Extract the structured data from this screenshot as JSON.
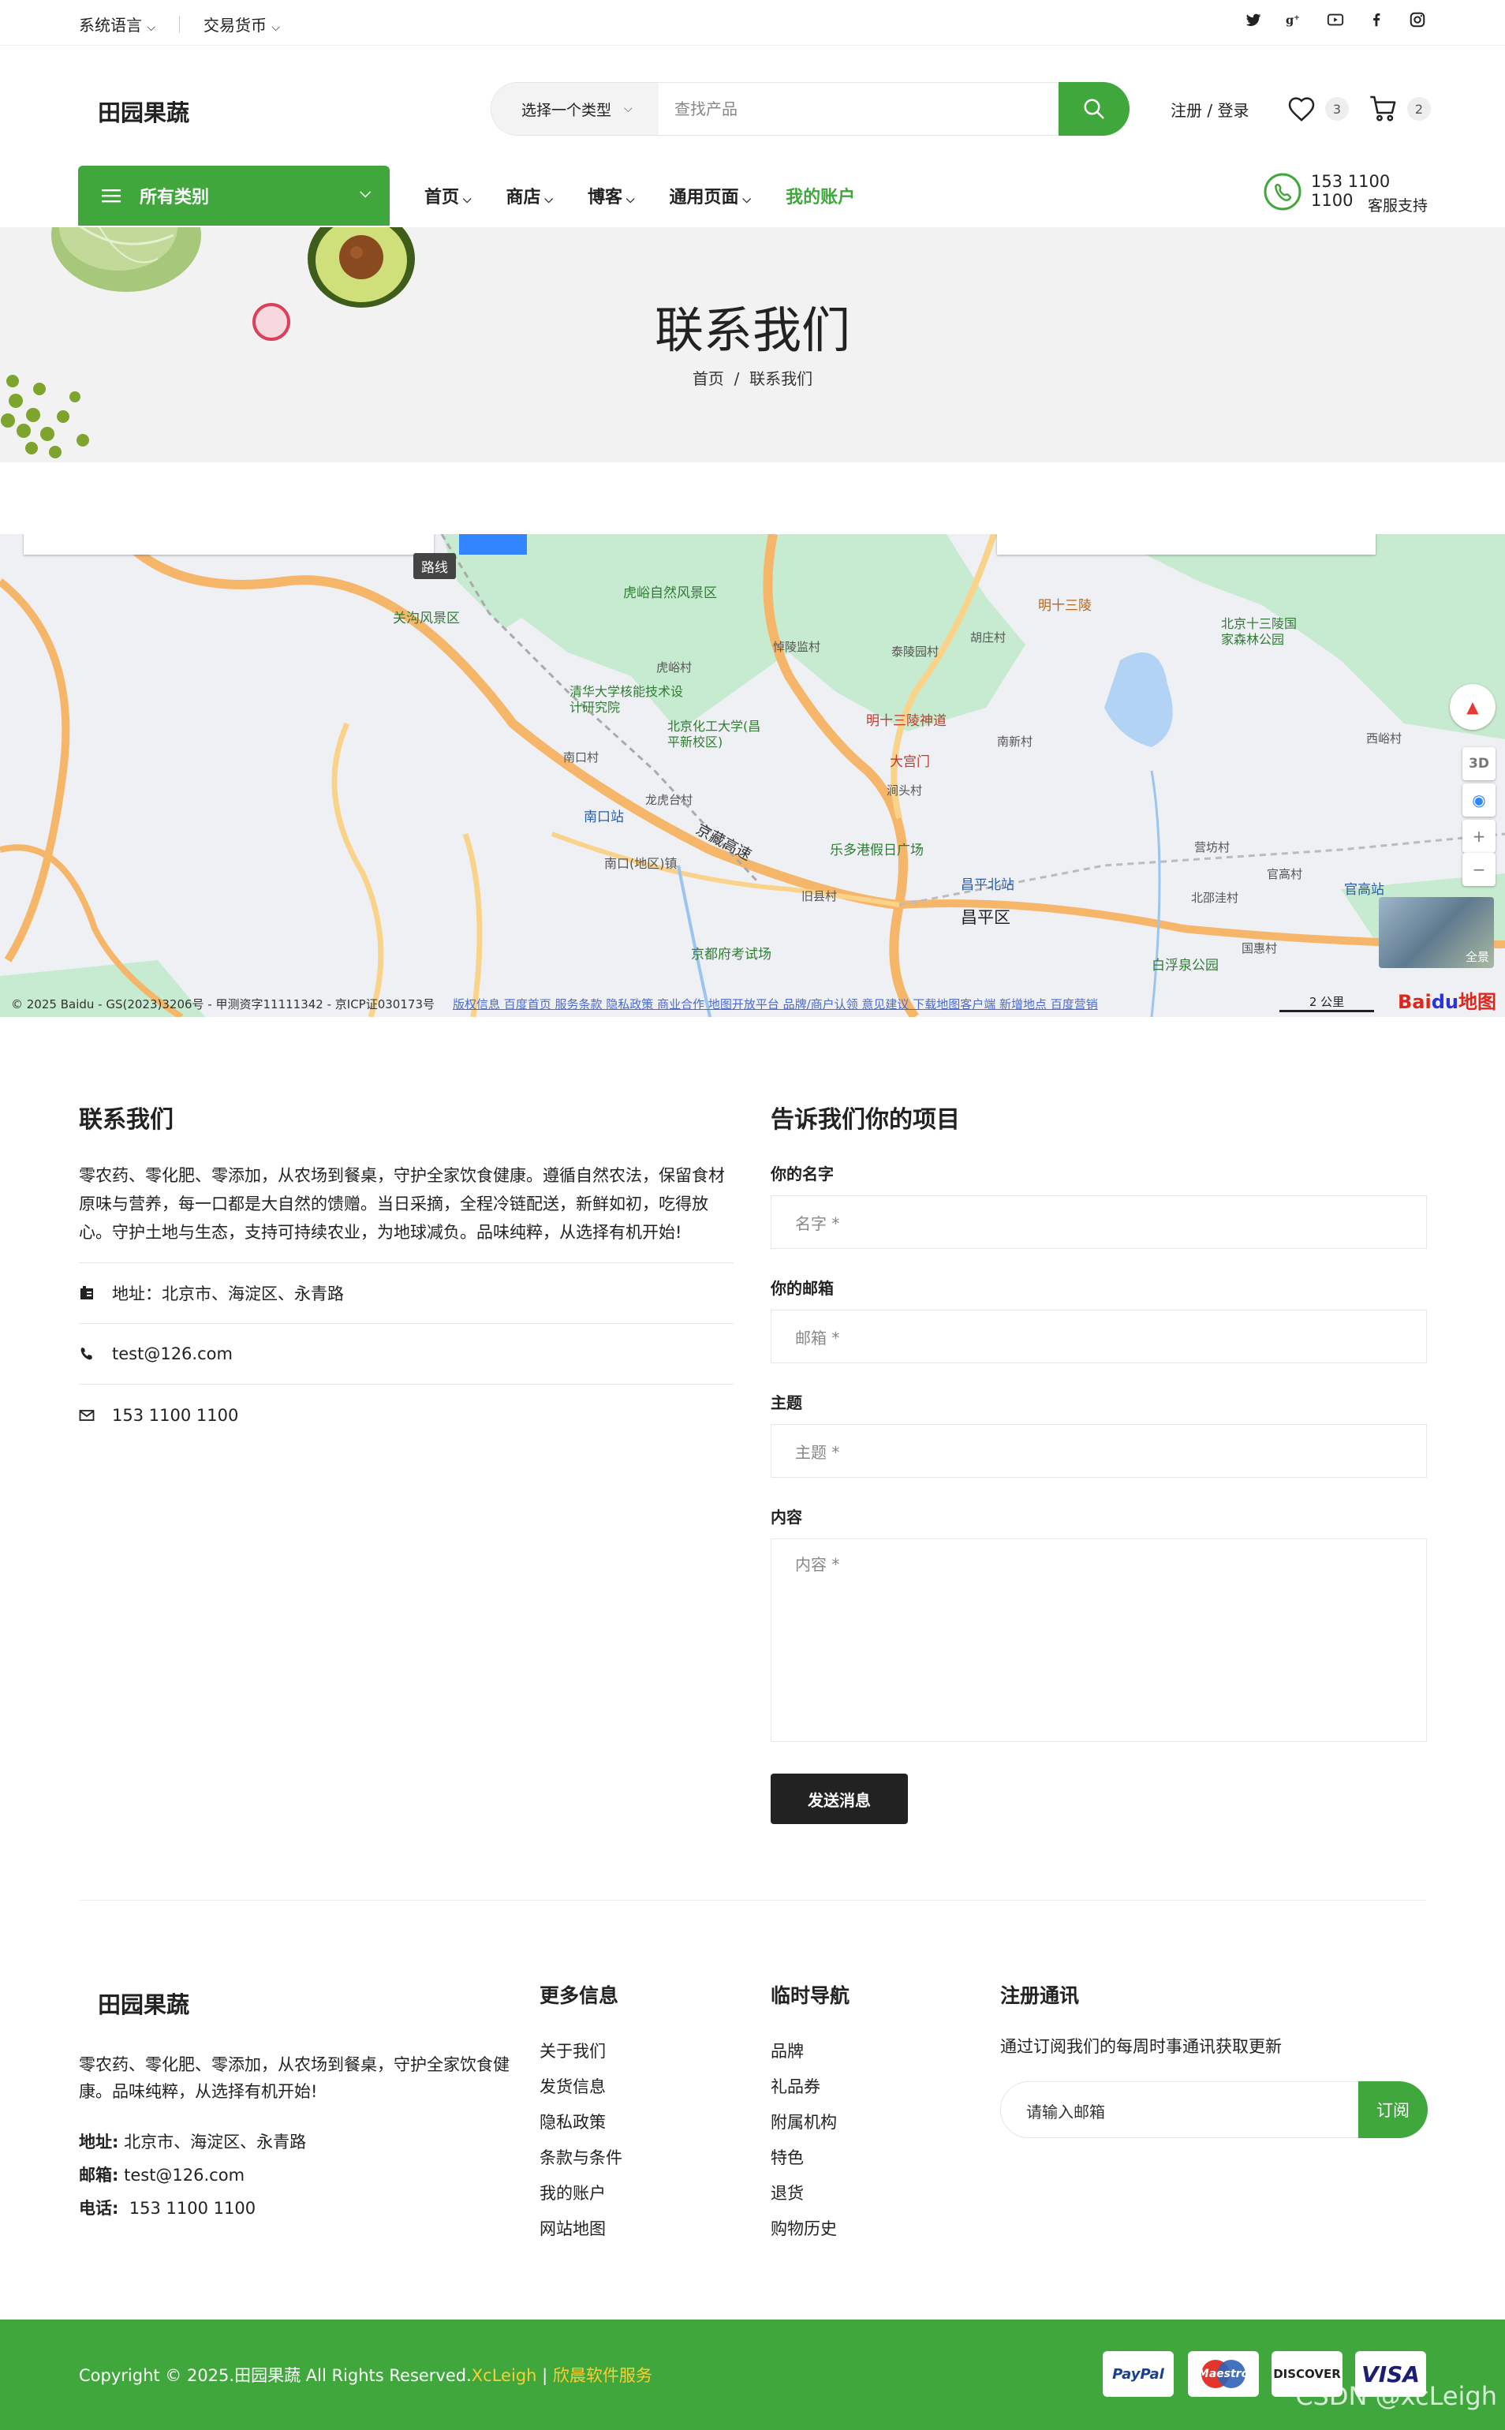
{
  "topbar": {
    "language": "系统语言",
    "currency": "交易货币"
  },
  "header": {
    "logo": "田园果蔬",
    "search_category": "选择一个类型",
    "search_placeholder": "查找产品",
    "account": "注册 / 登录",
    "wishlist_count": "3",
    "cart_count": "2"
  },
  "nav": {
    "all_categories": "所有类别",
    "items": [
      {
        "label": "首页"
      },
      {
        "label": "商店"
      },
      {
        "label": "博客"
      },
      {
        "label": "通用页面"
      },
      {
        "label": "我的账户"
      }
    ],
    "support_phone": "153 1100 1100",
    "support_label": "客服支持"
  },
  "banner": {
    "title": "联系我们",
    "breadcrumb_home": "首页",
    "breadcrumb_sep": "/",
    "breadcrumb_current": "联系我们"
  },
  "map": {
    "route_label": "路线",
    "attribution": "© 2025 Baidu - GS(2023)3206号 - 甲测资字11111342 - 京ICP证030173号",
    "links": "版权信息  百度首页  服务条款  隐私政策  商业合作  地图开放平台  品牌/商户认领  意见建议  下载地图客户端  新增地点  百度营销",
    "scale": "2 公里",
    "panorama": "全景",
    "btn_3d": "3D",
    "places": [
      {
        "name": "虎峪自然风景区"
      },
      {
        "name": "明十三陵"
      },
      {
        "name": "关沟风景区"
      },
      {
        "name": "北京十三陵国家森林公园"
      },
      {
        "name": "清华大学核能技术设计研究院"
      },
      {
        "name": "北京化工大学(昌平新校区)"
      },
      {
        "name": "明十三陵神道"
      },
      {
        "name": "大宫门"
      },
      {
        "name": "南口站"
      },
      {
        "name": "京藏高速"
      },
      {
        "name": "乐多港假日广场"
      },
      {
        "name": "昌平北站"
      },
      {
        "name": "昌平区"
      },
      {
        "name": "官高站"
      },
      {
        "name": "京都府考试场"
      },
      {
        "name": "白浮泉公园"
      },
      {
        "name": "南口(地区)镇"
      },
      {
        "name": "西峪村"
      },
      {
        "name": "营坊村"
      },
      {
        "name": "北邵洼村"
      },
      {
        "name": "旧县村"
      },
      {
        "name": "龙虎台村"
      },
      {
        "name": "南口村"
      },
      {
        "name": "虎峪村"
      },
      {
        "name": "悼陵监村"
      },
      {
        "name": "泰陵园村"
      },
      {
        "name": "胡庄村"
      },
      {
        "name": "南新村"
      },
      {
        "name": "涧头村"
      },
      {
        "name": "国惠村"
      },
      {
        "name": "官高村"
      }
    ]
  },
  "contact": {
    "title": "联系我们",
    "desc": "零农药、零化肥、零添加，从农场到餐桌，守护全家饮食健康。遵循自然农法，保留食材原味与营养，每一口都是大自然的馈赠。当日采摘，全程冷链配送，新鲜如初，吃得放心。守护土地与生态，支持可持续农业，为地球减负。品味纯粹，从选择有机开始!",
    "address": "地址：北京市、海淀区、永青路",
    "email": "test@126.com",
    "phone": "153 1100 1100"
  },
  "form": {
    "title": "告诉我们你的项目",
    "name_label": "你的名字",
    "name_placeholder": "名字 *",
    "email_label": "你的邮箱",
    "email_placeholder": "邮箱 *",
    "subject_label": "主题",
    "subject_placeholder": "主题 *",
    "content_label": "内容",
    "content_placeholder": "内容 *",
    "submit": "发送消息"
  },
  "footer": {
    "logo": "田园果蔬",
    "desc": "零农药、零化肥、零添加，从农场到餐桌，守护全家饮食健康。品味纯粹，从选择有机开始!",
    "address_label": "地址:",
    "address": "北京市、海淀区、永青路",
    "email_label": "邮箱:",
    "email": "test@126.com",
    "phone_label": "电话:",
    "phone": "153 1100 1100",
    "col1_title": "更多信息",
    "col1": [
      "关于我们",
      "发货信息",
      "隐私政策",
      "条款与条件",
      "我的账户",
      "网站地图"
    ],
    "col2_title": "临时导航",
    "col2": [
      "品牌",
      "礼品券",
      "附属机构",
      "特色",
      "退货",
      "购物历史"
    ],
    "newsletter_title": "注册通讯",
    "newsletter_desc": "通过订阅我们的每周时事通讯获取更新",
    "newsletter_placeholder": "请输入邮箱",
    "newsletter_button": "订阅"
  },
  "copyright": {
    "text": "Copyright © 2025.田园果蔬 All Rights Reserved.",
    "link1": "XcLeigh",
    "sep": " | ",
    "link2": "欣晨软件服务"
  },
  "payments": [
    "PayPal",
    "Maestro",
    "DISCOVER",
    "VISA"
  ],
  "watermark": "CSDN @xcLeigh",
  "colors": {
    "accent": "#3fa73c",
    "dark": "#222222",
    "highlight": "#ffcc33"
  }
}
